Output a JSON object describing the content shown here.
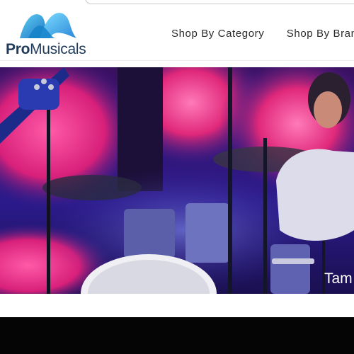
{
  "logo": {
    "part1": "Pro",
    "part2": "Musicals"
  },
  "nav": {
    "items": [
      {
        "label": "Shop By Category"
      },
      {
        "label": "Shop By Bran"
      }
    ]
  },
  "hero": {
    "caption": "Tam",
    "image": "drummer-on-stage"
  },
  "colors": {
    "logo_blue": "#29a8e0",
    "logo_navy": "#1f3a5a",
    "hero_pink": "#e0287a",
    "hero_purple": "#3a1f8a",
    "footer": "#050505"
  }
}
